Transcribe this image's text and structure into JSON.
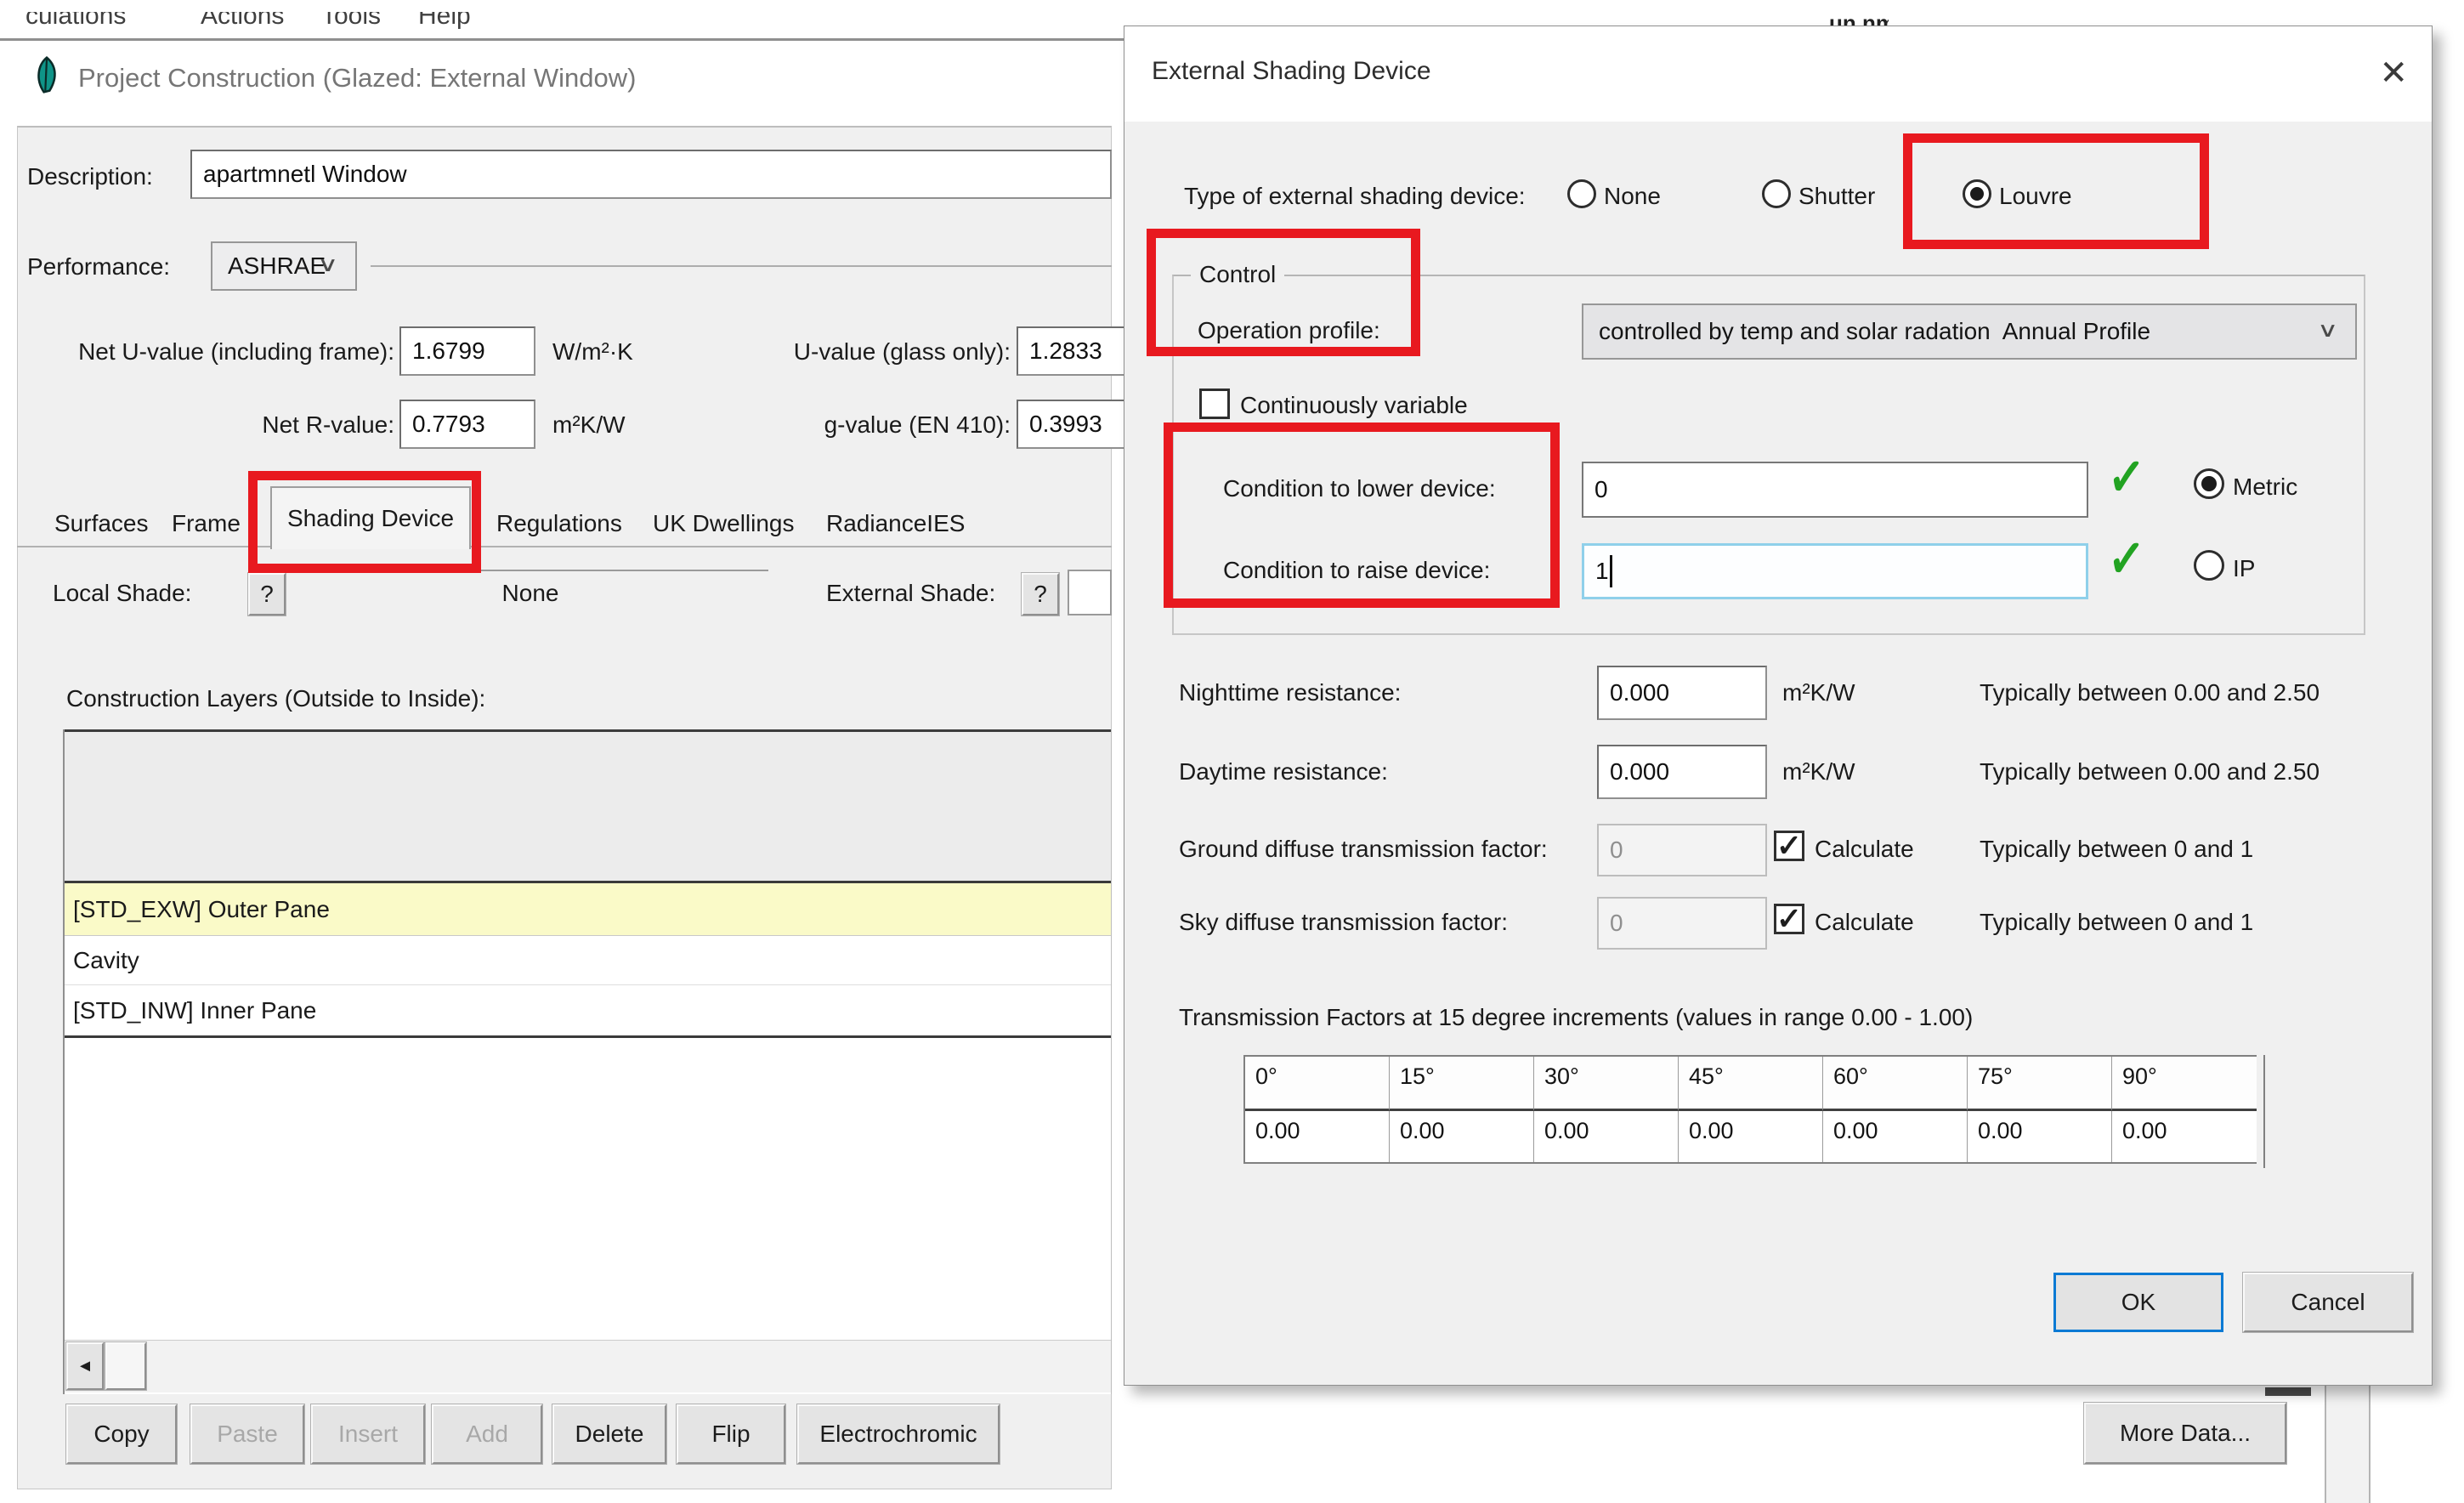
{
  "icons": {
    "close": "✕",
    "chevron_down": "∨",
    "check": "✓",
    "left_arrow": "◄",
    "app_icon": "feather-leaf"
  },
  "menu": {
    "items": [
      "culations",
      "Actions",
      "Tools",
      "Help"
    ],
    "right_fragment": "un nm"
  },
  "main": {
    "title": "Project Construction (Glazed: External Window)",
    "description": {
      "label": "Description:",
      "value": "apartmnetl Window"
    },
    "performance": {
      "label": "Performance:",
      "value": "ASHRAE"
    },
    "metrics": {
      "net_u": {
        "label": "Net U-value (including frame):",
        "value": "1.6799",
        "unit": "W/m²·K"
      },
      "u_glass": {
        "label": "U-value (glass only):",
        "value": "1.2833"
      },
      "net_r": {
        "label": "Net R-value:",
        "value": "0.7793",
        "unit": "m²K/W"
      },
      "g_value": {
        "label": "g-value (EN 410):",
        "value": "0.3993"
      }
    },
    "tabs": {
      "items": [
        "Surfaces",
        "Frame",
        "Shading Device",
        "Regulations",
        "UK Dwellings",
        "RadianceIES"
      ],
      "active": "Shading Device"
    },
    "shade": {
      "local_label": "Local Shade:",
      "local_help": "?",
      "local_value": "None",
      "external_label": "External Shade:",
      "external_help": "?"
    },
    "layers": {
      "label": "Construction Layers (Outside to Inside):",
      "rows": [
        "[STD_EXW] Outer Pane",
        "Cavity",
        "[STD_INW] Inner Pane"
      ]
    },
    "buttons": {
      "copy": "Copy",
      "paste": "Paste",
      "insert": "Insert",
      "add": "Add",
      "delete": "Delete",
      "flip": "Flip",
      "electrochromic": "Electrochromic",
      "more_data": "More Data..."
    }
  },
  "dialog": {
    "title": "External Shading Device",
    "type": {
      "label": "Type of external shading device:",
      "options": [
        {
          "label": "None",
          "selected": false
        },
        {
          "label": "Shutter",
          "selected": false
        },
        {
          "label": "Louvre",
          "selected": true
        }
      ]
    },
    "control": {
      "legend": "Control",
      "operation": {
        "label": "Operation profile:",
        "value": "controlled by temp and solar radation  Annual Profile"
      },
      "continuously_variable": {
        "label": "Continuously variable",
        "checked": false
      },
      "lower": {
        "label": "Condition to lower device:",
        "value": "0",
        "valid": true
      },
      "raise": {
        "label": "Condition to raise device:",
        "value": "1",
        "valid": true
      },
      "units": {
        "metric": "Metric",
        "ip": "IP",
        "selected": "Metric"
      }
    },
    "params": {
      "nighttime": {
        "label": "Nighttime resistance:",
        "value": "0.000",
        "unit": "m²K/W",
        "note": "Typically between 0.00 and 2.50"
      },
      "daytime": {
        "label": "Daytime resistance:",
        "value": "0.000",
        "unit": "m²K/W",
        "note": "Typically between 0.00 and 2.50"
      },
      "ground": {
        "label": "Ground diffuse transmission factor:",
        "value": "0",
        "checkbox": "Calculate",
        "checked": true,
        "note": "Typically between 0 and 1"
      },
      "sky": {
        "label": "Sky diffuse transmission factor:",
        "value": "0",
        "checkbox": "Calculate",
        "checked": true,
        "note": "Typically between 0 and 1"
      }
    },
    "transmission": {
      "label": "Transmission Factors at 15 degree increments (values in range  0.00 - 1.00)",
      "headers": [
        "0°",
        "15°",
        "30°",
        "45°",
        "60°",
        "75°",
        "90°"
      ],
      "values": [
        "0.00",
        "0.00",
        "0.00",
        "0.00",
        "0.00",
        "0.00",
        "0.00"
      ]
    },
    "actions": {
      "ok": "OK",
      "cancel": "Cancel"
    }
  },
  "colors": {
    "highlight_red": "#e8191f",
    "selected_row_yellow": "#fafac8",
    "check_green": "#22a322",
    "focus_blue": "#0a7ad4",
    "panel_gray": "#f0f0f0"
  }
}
